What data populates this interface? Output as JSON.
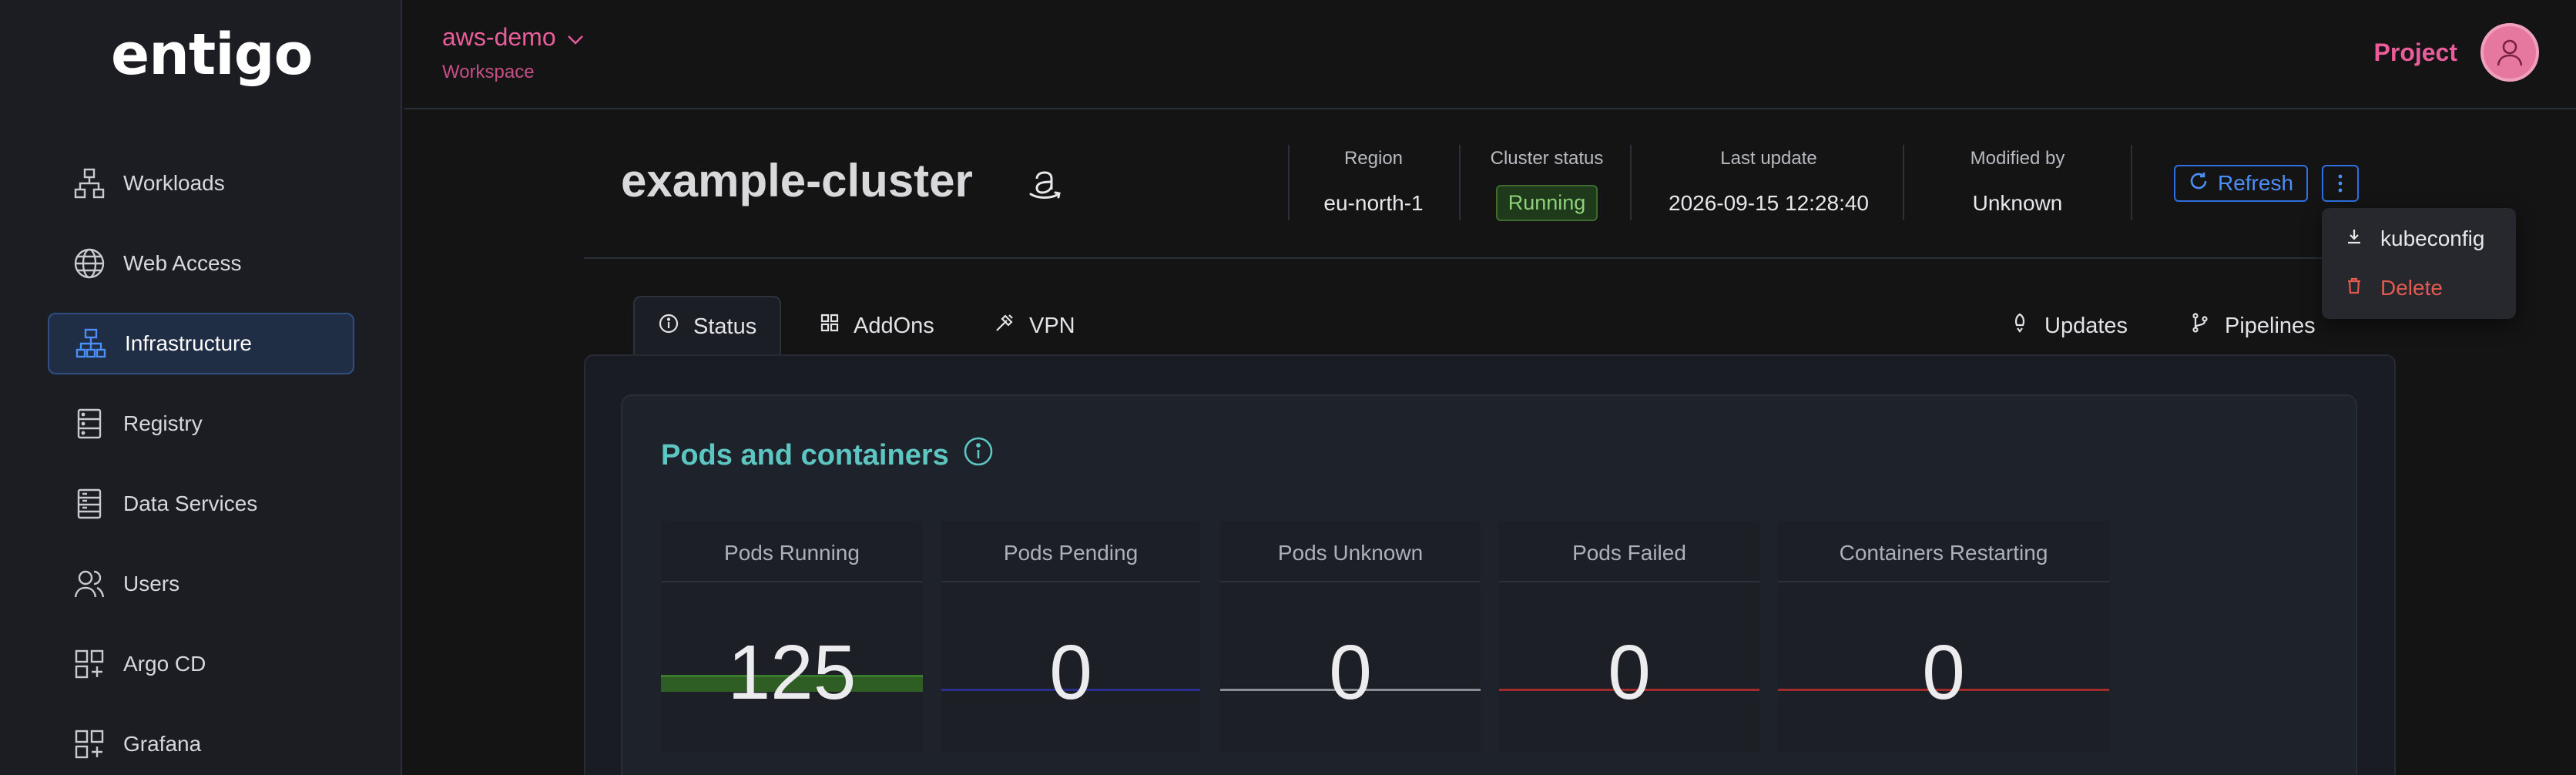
{
  "brand": {
    "logo_text": "entigo"
  },
  "sidebar": {
    "items": [
      {
        "label": "Workloads",
        "icon": "workloads-icon"
      },
      {
        "label": "Web Access",
        "icon": "globe-icon"
      },
      {
        "label": "Infrastructure",
        "icon": "infrastructure-icon",
        "active": true
      },
      {
        "label": "Registry",
        "icon": "registry-icon"
      },
      {
        "label": "Data Services",
        "icon": "data-services-icon"
      },
      {
        "label": "Users",
        "icon": "users-icon"
      },
      {
        "label": "Argo CD",
        "icon": "argo-cd-icon"
      },
      {
        "label": "Grafana",
        "icon": "grafana-icon"
      }
    ]
  },
  "topbar": {
    "workspace_name": "aws-demo",
    "workspace_label": "Workspace",
    "project_label": "Project"
  },
  "cluster": {
    "name": "example-cluster",
    "provider_icon": "amazon-icon",
    "region_label": "Region",
    "region": "eu-north-1",
    "status_label": "Cluster status",
    "status": "Running",
    "last_update_label": "Last update",
    "last_update": "2026-09-15 12:28:40",
    "modified_by_label": "Modified by",
    "modified_by": "Unknown",
    "refresh_label": "Refresh"
  },
  "menu": {
    "kubeconfig_label": "kubeconfig",
    "delete_label": "Delete"
  },
  "tabs": {
    "status": "Status",
    "addons": "AddOns",
    "vpn": "VPN",
    "updates": "Updates",
    "pipelines": "Pipelines"
  },
  "pods": {
    "title": "Pods and containers",
    "stats": [
      {
        "label": "Pods Running",
        "value": "125",
        "color": "#3a7a2c"
      },
      {
        "label": "Pods Pending",
        "value": "0",
        "color": "#2a2f8f"
      },
      {
        "label": "Pods Unknown",
        "value": "0",
        "color": "#8a8c92"
      },
      {
        "label": "Pods Failed",
        "value": "0",
        "color": "#a32a2a"
      },
      {
        "label": "Containers Restarting",
        "value": "0",
        "color": "#a32a2a"
      }
    ]
  },
  "colors": {
    "accent_pink": "#e85d9a",
    "accent_blue": "#2f6fe0",
    "teal_title": "#5ec6c2",
    "status_green": "#8fd17a"
  }
}
